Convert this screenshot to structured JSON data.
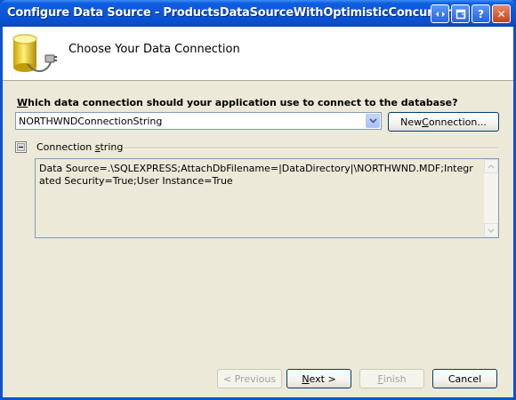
{
  "window": {
    "title": "Configure Data Source - ProductsDataSourceWithOptimisticConcurrency"
  },
  "titlebar_buttons": {
    "help_glyph": "?",
    "close_glyph": "✕"
  },
  "header": {
    "title": "Choose Your Data Connection",
    "icon": "database-plug-icon"
  },
  "connection": {
    "question_mnemonic": "W",
    "question_rest": "hich data connection should your application use to connect to the database?",
    "selected_value": "NORTHWNDConnectionString",
    "new_connection_pre": "New ",
    "new_connection_mnemonic": "C",
    "new_connection_post": "onnection..."
  },
  "connection_string": {
    "label_pre": "Connection ",
    "label_mnemonic": "s",
    "label_post": "tring",
    "value": "Data Source=.\\SQLEXPRESS;AttachDbFilename=|DataDirectory|\\NORTHWND.MDF;Integrated Security=True;User Instance=True"
  },
  "footer": {
    "previous_label": "< Previous",
    "previous_mnemonic": "P",
    "next_mnemonic": "N",
    "next_post": "ext >",
    "finish_mnemonic": "F",
    "finish_post": "inish",
    "cancel_label": "Cancel"
  },
  "colors": {
    "titlebar": "#0a52d6",
    "dialog_face": "#ece9d8",
    "header_bg": "#ffffff",
    "button_border": "#003c74",
    "disabled_text": "#a5a397"
  }
}
